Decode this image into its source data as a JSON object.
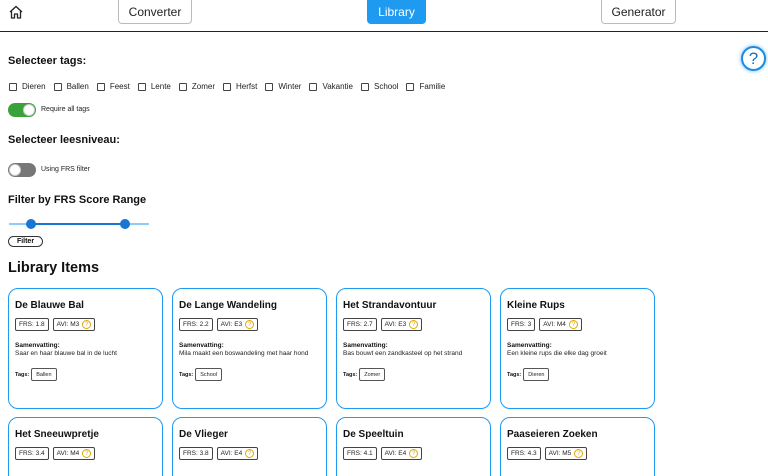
{
  "nav": {
    "home_icon": "home-icon",
    "converter": "Converter",
    "library": "Library",
    "generator": "Generator",
    "accent": "#1e9bf0"
  },
  "help": {
    "label": "?"
  },
  "tags_section": {
    "title": "Selecteer tags:",
    "tags": [
      "Dieren",
      "Ballen",
      "Feest",
      "Lente",
      "Zomer",
      "Herfst",
      "Winter",
      "Vakantie",
      "School",
      "Familie"
    ],
    "require_all_label": "Require all tags",
    "require_all_on": true
  },
  "level_section": {
    "title": "Selecteer leesniveau:",
    "frs_filter_label": "Using FRS filter",
    "frs_filter_on": false
  },
  "frs_range": {
    "title": "Filter by FRS Score Range",
    "low_fraction": 0.16,
    "high_fraction": 0.83,
    "filter_button": "Filter"
  },
  "library": {
    "title": "Library Items",
    "summary_label": "Samenvatting:",
    "tags_label": "Tags:",
    "items": [
      {
        "title": "De Blauwe Bal",
        "frs": "FRS: 1.8",
        "avi": "AVI: M3",
        "summary": "Saar en haar blauwe bal in de lucht",
        "tags": [
          "Ballen"
        ]
      },
      {
        "title": "De Lange Wandeling",
        "frs": "FRS: 2.2",
        "avi": "AVI: E3",
        "summary": "Mila maakt een boswandeling met haar hond",
        "tags": [
          "School"
        ]
      },
      {
        "title": "Het Strandavontuur",
        "frs": "FRS: 2.7",
        "avi": "AVI: E3",
        "summary": "Bas bouwt een zandkasteel op het strand",
        "tags": [
          "Zomer"
        ]
      },
      {
        "title": "Kleine Rups",
        "frs": "FRS: 3",
        "avi": "AVI: M4",
        "summary": "Een kleine rups die elke dag groeit",
        "tags": [
          "Dieren"
        ]
      },
      {
        "title": "Het Sneeuwpretje",
        "frs": "FRS: 3.4",
        "avi": "AVI: M4"
      },
      {
        "title": "De Vlieger",
        "frs": "FRS: 3.8",
        "avi": "AVI: E4"
      },
      {
        "title": "De Speeltuin",
        "frs": "FRS: 4.1",
        "avi": "AVI: E4"
      },
      {
        "title": "Paaseieren Zoeken",
        "frs": "FRS: 4.3",
        "avi": "AVI: M5"
      }
    ]
  }
}
